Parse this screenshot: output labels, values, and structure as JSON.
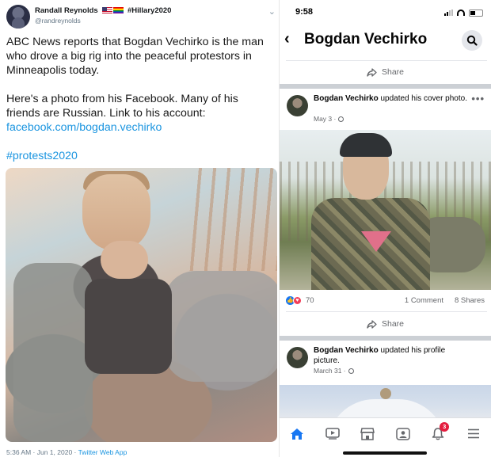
{
  "tweet": {
    "author_name": "Randall Reynolds",
    "name_hashtag": "#Hillary2020",
    "handle": "@randreynolds",
    "text_line1": "ABC News reports that Bogdan Vechirko is the man who drove a big rig into the peaceful protestors in Minneapolis today.",
    "text_line2": "Here's a photo from his Facebook. Many of his friends are Russian. Link to his account:",
    "link": "facebook.com/bogdan.vechirko",
    "hashtag": "#protests2020",
    "timestamp": "5:36 AM · Jun 1, 2020 · ",
    "source": "Twitter Web App",
    "icons": {
      "menu": "chevron-down-icon",
      "flags": [
        "us-flag-icon",
        "rainbow-flag-icon"
      ]
    }
  },
  "phone": {
    "status_time": "9:58",
    "page_title": "Bogdan Vechirko",
    "share_label": "Share",
    "posts": [
      {
        "author": "Bogdan Vechirko",
        "action": " updated his cover photo.",
        "date": "May 3 · ",
        "reactions": "70",
        "comments": "1 Comment",
        "shares": "8 Shares"
      },
      {
        "author": "Bogdan Vechirko",
        "action": " updated his profile picture.",
        "date": "March 31 · "
      }
    ],
    "tabs": [
      "home-tab",
      "watch-tab",
      "marketplace-tab",
      "groups-tab",
      "notifications-tab",
      "menu-tab"
    ],
    "notification_badge": "3",
    "colors": {
      "fb_blue": "#1877f2",
      "twitter_blue": "#1b95e0",
      "badge_red": "#e41e3f"
    }
  }
}
